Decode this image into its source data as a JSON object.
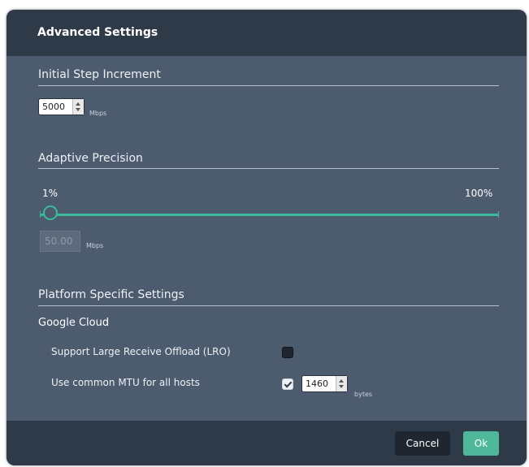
{
  "dialog": {
    "title": "Advanced Settings"
  },
  "initial_step": {
    "heading": "Initial Step Increment",
    "value": "5000",
    "unit": "Mbps"
  },
  "adaptive_precision": {
    "heading": "Adaptive Precision",
    "min_label": "1%",
    "max_label": "100%",
    "slider_value_fraction": 0.0,
    "value": "50.00",
    "unit": "Mbps"
  },
  "platform": {
    "heading": "Platform Specific Settings",
    "provider": "Google Cloud",
    "lro_label": "Support Large Receive Offload (LRO)",
    "lro_checked": false,
    "mtu_label": "Use common MTU for all hosts",
    "mtu_checked": true,
    "mtu_value": "1460",
    "mtu_unit": "bytes"
  },
  "footer": {
    "cancel_label": "Cancel",
    "ok_label": "Ok"
  },
  "colors": {
    "accent": "#3db89a",
    "header_bg": "#2f3a48",
    "body_bg": "#4d5b6f"
  }
}
